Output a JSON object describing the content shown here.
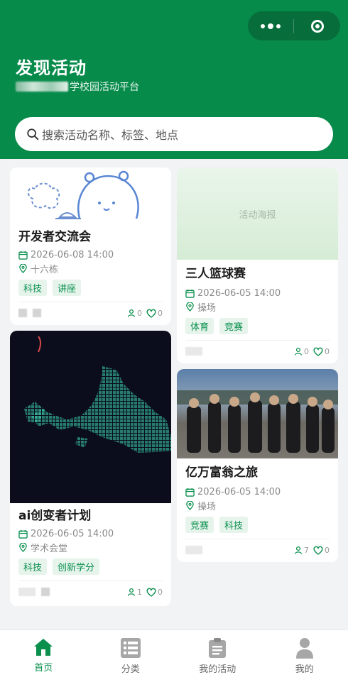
{
  "header": {
    "title": "发现活动",
    "subtitle_suffix": "学校园活动平台"
  },
  "search": {
    "placeholder": "搜索活动名称、标签、地点"
  },
  "cards": [
    {
      "title": "开发者交流会",
      "datetime": "2026-06-08 14:00",
      "location": "十六栋",
      "tags": [
        "科技",
        "讲座"
      ],
      "participants": "0",
      "likes": "0"
    },
    {
      "cover_text": "活动海报",
      "title": "三人篮球赛",
      "datetime": "2026-06-05 14:00",
      "location": "操场",
      "tags": [
        "体育",
        "竞赛"
      ],
      "participants": "0",
      "likes": "0"
    },
    {
      "title": "ai创变者计划",
      "datetime": "2026-06-05 14:00",
      "location": "学术会堂",
      "tags": [
        "科技",
        "创新学分"
      ],
      "participants": "1",
      "likes": "0"
    },
    {
      "title": "亿万富翁之旅",
      "datetime": "2026-06-05 14:00",
      "location": "操场",
      "tags": [
        "竞赛",
        "科技"
      ],
      "participants": "7",
      "likes": "0"
    }
  ],
  "tabbar": {
    "items": [
      {
        "label": "首页",
        "icon": "home-icon",
        "active": true
      },
      {
        "label": "分类",
        "icon": "category-icon",
        "active": false
      },
      {
        "label": "我的活动",
        "icon": "clipboard-icon",
        "active": false
      },
      {
        "label": "我的",
        "icon": "user-icon",
        "active": false
      }
    ]
  },
  "colors": {
    "brand_green": "#078b4b",
    "tag_bg": "#e6f4ec",
    "tag_text": "#0a8f4d"
  }
}
